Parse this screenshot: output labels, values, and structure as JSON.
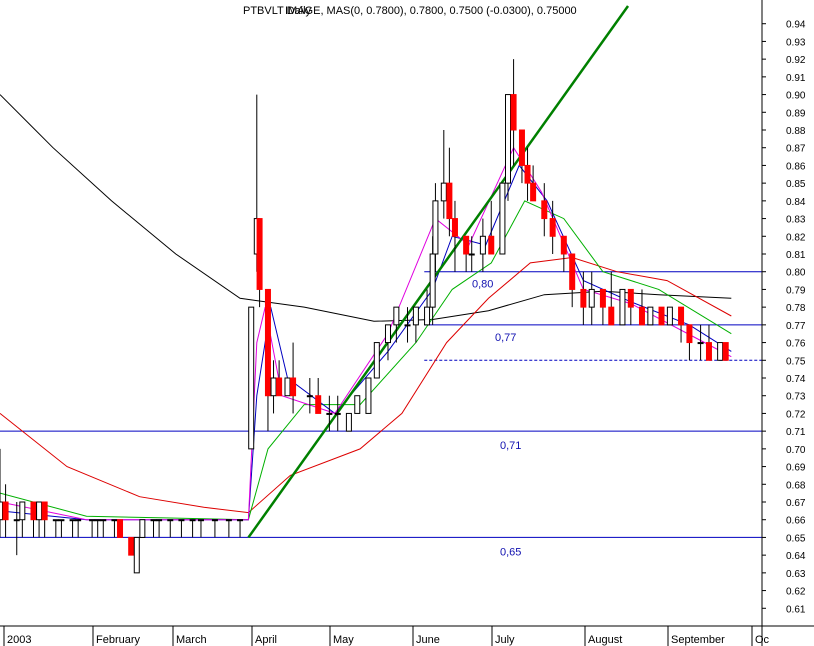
{
  "header": {
    "title": "PTBVLT Daily",
    "overlapping_text": "IMAGE, MAS(0, 0.7800), 0.7800, 0.7500 (-0.0300), 0.75000"
  },
  "colors": {
    "down_candle": "#ff0000",
    "up_candle": "#ffffff",
    "wick": "#000000",
    "ma_fast": "#e000e0",
    "ma_short": "#0000c0",
    "ma_mid": "#00b000",
    "ma_long": "#dd0000",
    "ma_slow": "#000000",
    "trendline": "#008000",
    "level_line": "#0000c0"
  },
  "chart_data": {
    "type": "candlestick",
    "y_axis": {
      "side": "right",
      "ylim": [
        0.6,
        0.95
      ],
      "ticks": [
        "0.94",
        "0.93",
        "0.92",
        "0.91",
        "0.90",
        "0.89",
        "0.88",
        "0.87",
        "0.86",
        "0.85",
        "0.84",
        "0.83",
        "0.82",
        "0.81",
        "0.80",
        "0.79",
        "0.78",
        "0.77",
        "0.76",
        "0.75",
        "0.74",
        "0.73",
        "0.72",
        "0.71",
        "0.70",
        "0.69",
        "0.68",
        "0.67",
        "0.66",
        "0.65",
        "0.64",
        "0.63",
        "0.62",
        "0.61"
      ]
    },
    "x_axis": {
      "labels": [
        "2003",
        "February",
        "March",
        "April",
        "May",
        "June",
        "July",
        "August",
        "September",
        "Oc"
      ],
      "range": [
        "2003-01-01",
        "2003-10-01"
      ]
    },
    "level_lines": [
      {
        "value": 0.8,
        "label": "0,80",
        "start": "2003-06-02"
      },
      {
        "value": 0.77,
        "label": "0,77",
        "start": "2003-06-02"
      },
      {
        "value": 0.75,
        "label": "",
        "start": "2003-06-02",
        "dashed": true
      },
      {
        "value": 0.71,
        "label": "0,71",
        "start": "2003-01-01"
      },
      {
        "value": 0.65,
        "label": "0,65",
        "start": "2003-01-01"
      }
    ],
    "trendline": {
      "from": [
        "2003-03-31",
        0.65
      ],
      "to": [
        "2003-08-14",
        0.95
      ]
    },
    "candles": [
      {
        "date": "2003-01-01",
        "o": 0.66,
        "h": 0.7,
        "l": 0.65,
        "c": 0.67
      },
      {
        "date": "2003-01-03",
        "o": 0.67,
        "h": 0.68,
        "l": 0.65,
        "c": 0.66
      },
      {
        "date": "2003-01-07",
        "o": 0.66,
        "h": 0.67,
        "l": 0.64,
        "c": 0.66
      },
      {
        "date": "2003-01-09",
        "o": 0.66,
        "h": 0.67,
        "l": 0.65,
        "c": 0.67
      },
      {
        "date": "2003-01-13",
        "o": 0.67,
        "h": 0.67,
        "l": 0.65,
        "c": 0.66
      },
      {
        "date": "2003-01-15",
        "o": 0.66,
        "h": 0.67,
        "l": 0.65,
        "c": 0.67
      },
      {
        "date": "2003-01-17",
        "o": 0.67,
        "h": 0.67,
        "l": 0.65,
        "c": 0.66
      },
      {
        "date": "2003-01-21",
        "o": 0.66,
        "h": 0.66,
        "l": 0.65,
        "c": 0.66
      },
      {
        "date": "2003-01-23",
        "o": 0.66,
        "h": 0.66,
        "l": 0.65,
        "c": 0.66
      },
      {
        "date": "2003-01-27",
        "o": 0.66,
        "h": 0.66,
        "l": 0.65,
        "c": 0.66
      },
      {
        "date": "2003-01-29",
        "o": 0.66,
        "h": 0.66,
        "l": 0.65,
        "c": 0.66
      },
      {
        "date": "2003-02-03",
        "o": 0.66,
        "h": 0.66,
        "l": 0.65,
        "c": 0.66
      },
      {
        "date": "2003-02-05",
        "o": 0.66,
        "h": 0.66,
        "l": 0.65,
        "c": 0.66
      },
      {
        "date": "2003-02-07",
        "o": 0.66,
        "h": 0.66,
        "l": 0.65,
        "c": 0.66
      },
      {
        "date": "2003-02-11",
        "o": 0.66,
        "h": 0.66,
        "l": 0.65,
        "c": 0.66
      },
      {
        "date": "2003-02-13",
        "o": 0.66,
        "h": 0.66,
        "l": 0.65,
        "c": 0.65
      },
      {
        "date": "2003-02-17",
        "o": 0.65,
        "h": 0.65,
        "l": 0.64,
        "c": 0.64
      },
      {
        "date": "2003-02-19",
        "o": 0.63,
        "h": 0.65,
        "l": 0.63,
        "c": 0.65
      },
      {
        "date": "2003-02-21",
        "o": 0.65,
        "h": 0.66,
        "l": 0.65,
        "c": 0.66
      },
      {
        "date": "2003-02-25",
        "o": 0.66,
        "h": 0.66,
        "l": 0.65,
        "c": 0.66
      },
      {
        "date": "2003-02-27",
        "o": 0.66,
        "h": 0.66,
        "l": 0.65,
        "c": 0.66
      },
      {
        "date": "2003-03-03",
        "o": 0.66,
        "h": 0.66,
        "l": 0.65,
        "c": 0.66
      },
      {
        "date": "2003-03-07",
        "o": 0.66,
        "h": 0.66,
        "l": 0.65,
        "c": 0.66
      },
      {
        "date": "2003-03-11",
        "o": 0.66,
        "h": 0.66,
        "l": 0.65,
        "c": 0.66
      },
      {
        "date": "2003-03-14",
        "o": 0.66,
        "h": 0.66,
        "l": 0.65,
        "c": 0.66
      },
      {
        "date": "2003-03-19",
        "o": 0.66,
        "h": 0.66,
        "l": 0.65,
        "c": 0.66
      },
      {
        "date": "2003-03-24",
        "o": 0.66,
        "h": 0.66,
        "l": 0.65,
        "c": 0.66
      },
      {
        "date": "2003-03-28",
        "o": 0.66,
        "h": 0.66,
        "l": 0.65,
        "c": 0.66
      },
      {
        "date": "2003-04-01",
        "o": 0.7,
        "h": 0.78,
        "l": 0.7,
        "c": 0.78
      },
      {
        "date": "2003-04-03",
        "o": 0.81,
        "h": 0.9,
        "l": 0.8,
        "c": 0.83
      },
      {
        "date": "2003-04-04",
        "o": 0.83,
        "h": 0.83,
        "l": 0.78,
        "c": 0.79
      },
      {
        "date": "2003-04-07",
        "o": 0.79,
        "h": 0.79,
        "l": 0.71,
        "c": 0.73
      },
      {
        "date": "2003-04-09",
        "o": 0.73,
        "h": 0.75,
        "l": 0.72,
        "c": 0.74
      },
      {
        "date": "2003-04-11",
        "o": 0.74,
        "h": 0.75,
        "l": 0.73,
        "c": 0.73
      },
      {
        "date": "2003-04-14",
        "o": 0.73,
        "h": 0.74,
        "l": 0.73,
        "c": 0.74
      },
      {
        "date": "2003-04-16",
        "o": 0.74,
        "h": 0.76,
        "l": 0.72,
        "c": 0.73
      },
      {
        "date": "2003-04-22",
        "o": 0.73,
        "h": 0.74,
        "l": 0.72,
        "c": 0.73
      },
      {
        "date": "2003-04-25",
        "o": 0.73,
        "h": 0.74,
        "l": 0.72,
        "c": 0.72
      },
      {
        "date": "2003-04-29",
        "o": 0.72,
        "h": 0.73,
        "l": 0.71,
        "c": 0.72
      },
      {
        "date": "2003-05-02",
        "o": 0.72,
        "h": 0.73,
        "l": 0.71,
        "c": 0.72
      },
      {
        "date": "2003-05-06",
        "o": 0.71,
        "h": 0.72,
        "l": 0.71,
        "c": 0.72
      },
      {
        "date": "2003-05-09",
        "o": 0.72,
        "h": 0.73,
        "l": 0.72,
        "c": 0.73
      },
      {
        "date": "2003-05-13",
        "o": 0.72,
        "h": 0.74,
        "l": 0.72,
        "c": 0.74
      },
      {
        "date": "2003-05-16",
        "o": 0.74,
        "h": 0.76,
        "l": 0.74,
        "c": 0.76
      },
      {
        "date": "2003-05-20",
        "o": 0.76,
        "h": 0.77,
        "l": 0.75,
        "c": 0.77
      },
      {
        "date": "2003-05-23",
        "o": 0.77,
        "h": 0.78,
        "l": 0.76,
        "c": 0.78
      },
      {
        "date": "2003-05-27",
        "o": 0.77,
        "h": 0.78,
        "l": 0.76,
        "c": 0.77
      },
      {
        "date": "2003-05-30",
        "o": 0.77,
        "h": 0.78,
        "l": 0.76,
        "c": 0.78
      },
      {
        "date": "2003-06-03",
        "o": 0.77,
        "h": 0.79,
        "l": 0.77,
        "c": 0.78
      },
      {
        "date": "2003-06-05",
        "o": 0.78,
        "h": 0.82,
        "l": 0.77,
        "c": 0.81
      },
      {
        "date": "2003-06-06",
        "o": 0.81,
        "h": 0.85,
        "l": 0.8,
        "c": 0.84
      },
      {
        "date": "2003-06-09",
        "o": 0.84,
        "h": 0.88,
        "l": 0.83,
        "c": 0.85
      },
      {
        "date": "2003-06-11",
        "o": 0.85,
        "h": 0.87,
        "l": 0.82,
        "c": 0.83
      },
      {
        "date": "2003-06-13",
        "o": 0.83,
        "h": 0.84,
        "l": 0.8,
        "c": 0.82
      },
      {
        "date": "2003-06-17",
        "o": 0.82,
        "h": 0.82,
        "l": 0.8,
        "c": 0.81
      },
      {
        "date": "2003-06-19",
        "o": 0.81,
        "h": 0.82,
        "l": 0.8,
        "c": 0.81
      },
      {
        "date": "2003-06-23",
        "o": 0.81,
        "h": 0.83,
        "l": 0.8,
        "c": 0.82
      },
      {
        "date": "2003-06-26",
        "o": 0.82,
        "h": 0.84,
        "l": 0.81,
        "c": 0.81
      },
      {
        "date": "2003-06-30",
        "o": 0.81,
        "h": 0.85,
        "l": 0.81,
        "c": 0.85
      },
      {
        "date": "2003-07-02",
        "o": 0.85,
        "h": 0.9,
        "l": 0.84,
        "c": 0.9
      },
      {
        "date": "2003-07-04",
        "o": 0.9,
        "h": 0.92,
        "l": 0.86,
        "c": 0.88
      },
      {
        "date": "2003-07-07",
        "o": 0.88,
        "h": 0.88,
        "l": 0.85,
        "c": 0.86
      },
      {
        "date": "2003-07-09",
        "o": 0.86,
        "h": 0.87,
        "l": 0.84,
        "c": 0.85
      },
      {
        "date": "2003-07-11",
        "o": 0.85,
        "h": 0.86,
        "l": 0.84,
        "c": 0.84
      },
      {
        "date": "2003-07-15",
        "o": 0.84,
        "h": 0.85,
        "l": 0.82,
        "c": 0.83
      },
      {
        "date": "2003-07-18",
        "o": 0.83,
        "h": 0.84,
        "l": 0.81,
        "c": 0.82
      },
      {
        "date": "2003-07-22",
        "o": 0.82,
        "h": 0.82,
        "l": 0.8,
        "c": 0.81
      },
      {
        "date": "2003-07-25",
        "o": 0.81,
        "h": 0.81,
        "l": 0.78,
        "c": 0.79
      },
      {
        "date": "2003-07-29",
        "o": 0.79,
        "h": 0.8,
        "l": 0.77,
        "c": 0.78
      },
      {
        "date": "2003-08-01",
        "o": 0.78,
        "h": 0.8,
        "l": 0.77,
        "c": 0.79
      },
      {
        "date": "2003-08-05",
        "o": 0.79,
        "h": 0.79,
        "l": 0.77,
        "c": 0.78
      },
      {
        "date": "2003-08-08",
        "o": 0.78,
        "h": 0.8,
        "l": 0.77,
        "c": 0.77
      },
      {
        "date": "2003-08-12",
        "o": 0.77,
        "h": 0.79,
        "l": 0.77,
        "c": 0.79
      },
      {
        "date": "2003-08-15",
        "o": 0.79,
        "h": 0.79,
        "l": 0.77,
        "c": 0.78
      },
      {
        "date": "2003-08-19",
        "o": 0.78,
        "h": 0.79,
        "l": 0.77,
        "c": 0.77
      },
      {
        "date": "2003-08-22",
        "o": 0.77,
        "h": 0.78,
        "l": 0.77,
        "c": 0.78
      },
      {
        "date": "2003-08-26",
        "o": 0.78,
        "h": 0.78,
        "l": 0.77,
        "c": 0.77
      },
      {
        "date": "2003-08-29",
        "o": 0.77,
        "h": 0.78,
        "l": 0.77,
        "c": 0.78
      },
      {
        "date": "2003-09-02",
        "o": 0.78,
        "h": 0.78,
        "l": 0.76,
        "c": 0.77
      },
      {
        "date": "2003-09-05",
        "o": 0.77,
        "h": 0.77,
        "l": 0.75,
        "c": 0.76
      },
      {
        "date": "2003-09-09",
        "o": 0.76,
        "h": 0.77,
        "l": 0.75,
        "c": 0.76
      },
      {
        "date": "2003-09-12",
        "o": 0.76,
        "h": 0.77,
        "l": 0.75,
        "c": 0.75
      },
      {
        "date": "2003-09-16",
        "o": 0.75,
        "h": 0.76,
        "l": 0.75,
        "c": 0.76
      },
      {
        "date": "2003-09-18",
        "o": 0.76,
        "h": 0.76,
        "l": 0.75,
        "c": 0.75
      }
    ],
    "moving_averages": [
      {
        "color_key": "ma_slow",
        "points": [
          [
            "2003-01-01",
            0.9
          ],
          [
            "2003-01-20",
            0.87
          ],
          [
            "2003-02-10",
            0.84
          ],
          [
            "2003-03-05",
            0.81
          ],
          [
            "2003-03-28",
            0.785
          ],
          [
            "2003-04-20",
            0.78
          ],
          [
            "2003-05-15",
            0.772
          ],
          [
            "2003-06-05",
            0.773
          ],
          [
            "2003-06-25",
            0.778
          ],
          [
            "2003-07-15",
            0.787
          ],
          [
            "2003-08-05",
            0.789
          ],
          [
            "2003-08-25",
            0.787
          ],
          [
            "2003-09-20",
            0.785
          ]
        ]
      },
      {
        "color_key": "ma_long",
        "points": [
          [
            "2003-01-01",
            0.72
          ],
          [
            "2003-01-25",
            0.69
          ],
          [
            "2003-02-20",
            0.673
          ],
          [
            "2003-03-15",
            0.667
          ],
          [
            "2003-03-31",
            0.664
          ],
          [
            "2003-04-15",
            0.685
          ],
          [
            "2003-05-10",
            0.7
          ],
          [
            "2003-05-25",
            0.72
          ],
          [
            "2003-06-10",
            0.76
          ],
          [
            "2003-06-25",
            0.785
          ],
          [
            "2003-07-10",
            0.805
          ],
          [
            "2003-07-25",
            0.808
          ],
          [
            "2003-08-10",
            0.8
          ],
          [
            "2003-08-28",
            0.795
          ],
          [
            "2003-09-20",
            0.775
          ]
        ]
      },
      {
        "color_key": "ma_mid",
        "points": [
          [
            "2003-01-01",
            0.675
          ],
          [
            "2003-02-01",
            0.662
          ],
          [
            "2003-03-01",
            0.661
          ],
          [
            "2003-03-31",
            0.66
          ],
          [
            "2003-04-07",
            0.7
          ],
          [
            "2003-04-20",
            0.725
          ],
          [
            "2003-05-10",
            0.725
          ],
          [
            "2003-05-30",
            0.76
          ],
          [
            "2003-06-12",
            0.79
          ],
          [
            "2003-06-26",
            0.805
          ],
          [
            "2003-07-08",
            0.84
          ],
          [
            "2003-07-22",
            0.83
          ],
          [
            "2003-08-05",
            0.8
          ],
          [
            "2003-08-25",
            0.79
          ],
          [
            "2003-09-20",
            0.765
          ]
        ]
      },
      {
        "color_key": "ma_short",
        "points": [
          [
            "2003-01-01",
            0.665
          ],
          [
            "2003-02-01",
            0.66
          ],
          [
            "2003-03-01",
            0.66
          ],
          [
            "2003-03-31",
            0.66
          ],
          [
            "2003-04-03",
            0.73
          ],
          [
            "2003-04-08",
            0.78
          ],
          [
            "2003-04-14",
            0.74
          ],
          [
            "2003-05-01",
            0.72
          ],
          [
            "2003-05-20",
            0.755
          ],
          [
            "2003-06-05",
            0.79
          ],
          [
            "2003-06-12",
            0.82
          ],
          [
            "2003-06-24",
            0.815
          ],
          [
            "2003-07-06",
            0.86
          ],
          [
            "2003-07-16",
            0.84
          ],
          [
            "2003-07-29",
            0.795
          ],
          [
            "2003-08-15",
            0.783
          ],
          [
            "2003-09-05",
            0.77
          ],
          [
            "2003-09-20",
            0.755
          ]
        ]
      },
      {
        "color_key": "ma_fast",
        "points": [
          [
            "2003-01-01",
            0.67
          ],
          [
            "2003-02-01",
            0.66
          ],
          [
            "2003-03-01",
            0.66
          ],
          [
            "2003-03-31",
            0.66
          ],
          [
            "2003-04-03",
            0.76
          ],
          [
            "2003-04-06",
            0.78
          ],
          [
            "2003-04-12",
            0.73
          ],
          [
            "2003-05-01",
            0.72
          ],
          [
            "2003-05-20",
            0.765
          ],
          [
            "2003-06-06",
            0.83
          ],
          [
            "2003-06-18",
            0.815
          ],
          [
            "2003-07-04",
            0.87
          ],
          [
            "2003-07-14",
            0.845
          ],
          [
            "2003-07-29",
            0.79
          ],
          [
            "2003-08-15",
            0.782
          ],
          [
            "2003-09-08",
            0.762
          ],
          [
            "2003-09-20",
            0.752
          ]
        ]
      }
    ]
  }
}
